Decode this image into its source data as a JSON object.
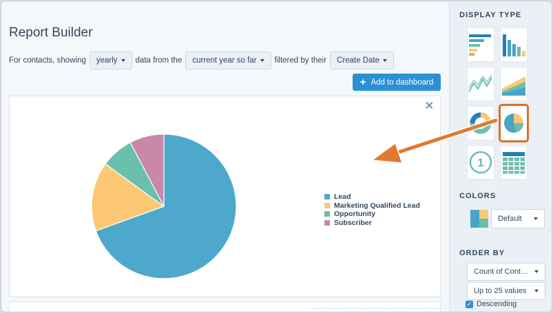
{
  "report": {
    "title": "Report Builder",
    "filter": {
      "prefix": "For contacts, showing",
      "frequency": "yearly",
      "mid_text": "data from the",
      "range": "current year so far",
      "filtered_text": "filtered by their",
      "property": "Create Date"
    },
    "add_button_label": "Add to dashboard",
    "close_glyph": "✕"
  },
  "chart_data": {
    "type": "pie",
    "categories": [
      "Lead",
      "Marketing Qualified Lead",
      "Opportunity",
      "Subscriber"
    ],
    "values": [
      69.5,
      15.5,
      7.3,
      7.7
    ],
    "colors": [
      "#4ea8cb",
      "#fdc875",
      "#6abfad",
      "#c987a9"
    ]
  },
  "legend": {
    "items": [
      {
        "label": "Lead",
        "color": "#4ea8cb"
      },
      {
        "label": "Marketing Qualified Lead",
        "color": "#fdc875"
      },
      {
        "label": "Opportunity",
        "color": "#6abfad"
      },
      {
        "label": "Subscriber",
        "color": "#c987a9"
      }
    ]
  },
  "panel": {
    "display_type_heading": "DISPLAY TYPE",
    "display_types": [
      "horizontal-bar-chart-icon",
      "vertical-bar-chart-icon",
      "line-chart-icon",
      "area-chart-icon",
      "donut-chart-icon",
      "pie-chart-icon",
      "single-value-icon",
      "table-icon"
    ],
    "selected_display_type": "pie-chart-icon",
    "single_value_glyph": "1",
    "colors_heading": "COLORS",
    "color_scheme": "Default",
    "order_by_heading": "ORDER BY",
    "order_field": "Count of Cont…",
    "limit": "Up to 25 values",
    "descending_label": "Descending",
    "descending_checked": true
  },
  "accent_colors": {
    "button_blue": "#2b90d4",
    "highlight_orange": "#d56f2a"
  }
}
